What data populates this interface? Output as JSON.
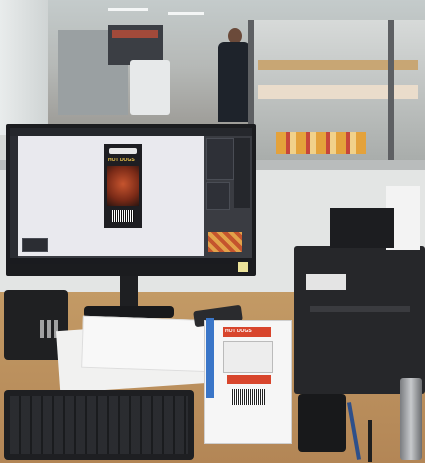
{
  "photo": {
    "subject": "office desk with computer monitor in front of a glass window overlooking a flexible packaging print production floor",
    "monitor": {
      "screen_app": "packaging artwork prepress software",
      "artwork_label_title": "HOT DOGS",
      "monitor_brand_mark": ""
    },
    "printed_proofs": {
      "label_text": "HOT DOGS"
    },
    "colors": {
      "window_glass": "#c9d3d6",
      "factory_floor": "#8e8a84",
      "desk_wood": "#c9a06b",
      "monitor_body": "#1b1c1f",
      "screen_canvas": "#e9e9ee",
      "screen_panel": "#2b2d33",
      "printer_body": "#26272a",
      "keyboard": "#1e1f22",
      "proof_accent": "#d8452c"
    }
  }
}
